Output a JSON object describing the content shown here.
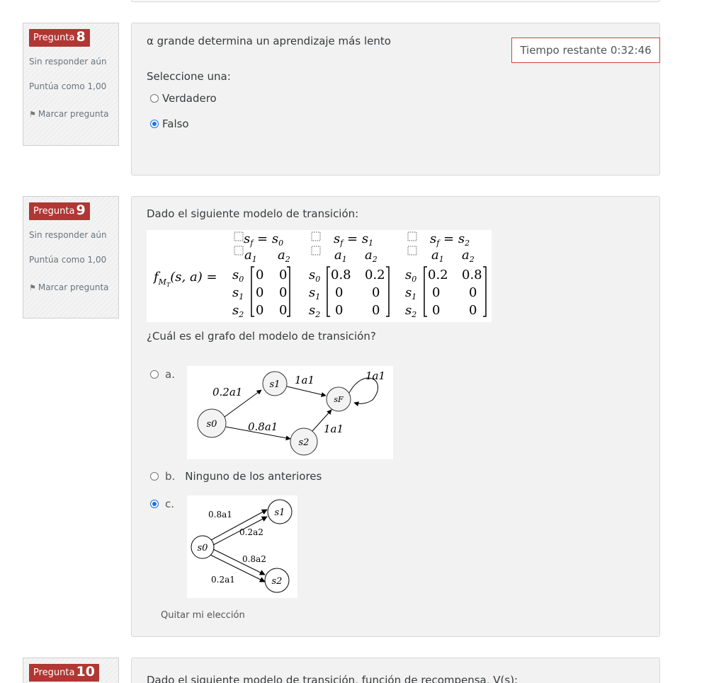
{
  "timer": {
    "label": "Tiempo restante 0:32:46"
  },
  "q8": {
    "label": "Pregunta",
    "number": "8",
    "state": "Sin responder aún",
    "grade": "Puntúa como 1,00",
    "flag_label": "Marcar pregunta",
    "text": "α grande determina un aprendizaje más lento",
    "prompt": "Seleccione una:",
    "options": [
      {
        "label": "Verdadero",
        "checked": false
      },
      {
        "label": "Falso",
        "checked": true
      }
    ]
  },
  "q9": {
    "label": "Pregunta",
    "number": "9",
    "state": "Sin responder aún",
    "grade": "Puntúa como 1,00",
    "flag_label": "Marcar pregunta",
    "text": "Dado el siguiente modelo de transición:",
    "matrix": {
      "lhs": "f",
      "headers": [
        "s_f = s_0",
        "s_f = s_1",
        "s_f = s_2"
      ],
      "actions": [
        "a1",
        "a2"
      ],
      "states": [
        "s0",
        "s1",
        "s2"
      ],
      "m0": [
        [
          "0",
          "0"
        ],
        [
          "0",
          "0"
        ],
        [
          "0",
          "0"
        ]
      ],
      "m1": [
        [
          "0.8",
          "0.2"
        ],
        [
          "0",
          "0"
        ],
        [
          "0",
          "0"
        ]
      ],
      "m2": [
        [
          "0.2",
          "0.8"
        ],
        [
          "0",
          "0"
        ],
        [
          "0",
          "0"
        ]
      ]
    },
    "question": "¿Cuál es el grafo del modelo de transición?",
    "options": [
      {
        "letter": "a.",
        "label": "",
        "checked": false
      },
      {
        "letter": "b.",
        "label": "Ninguno de los anteriores",
        "checked": false
      },
      {
        "letter": "c.",
        "label": "",
        "checked": true
      }
    ],
    "graph_a": {
      "labels": [
        "0.2a1",
        "1a1",
        "1a1",
        "0.8a1",
        "1a1"
      ],
      "nodes": [
        "s1",
        "sF",
        "s0",
        "s2"
      ]
    },
    "graph_c": {
      "labels": [
        "0.8a1",
        "0.2a2",
        "0.8a2",
        "0.2a1"
      ],
      "nodes": [
        "s1",
        "s0",
        "s2"
      ]
    },
    "clear": "Quitar mi elección"
  },
  "q10": {
    "label": "Pregunta",
    "number": "10",
    "text": "Dado el siguiente modelo de transición, función de recompensa, V(s):"
  }
}
